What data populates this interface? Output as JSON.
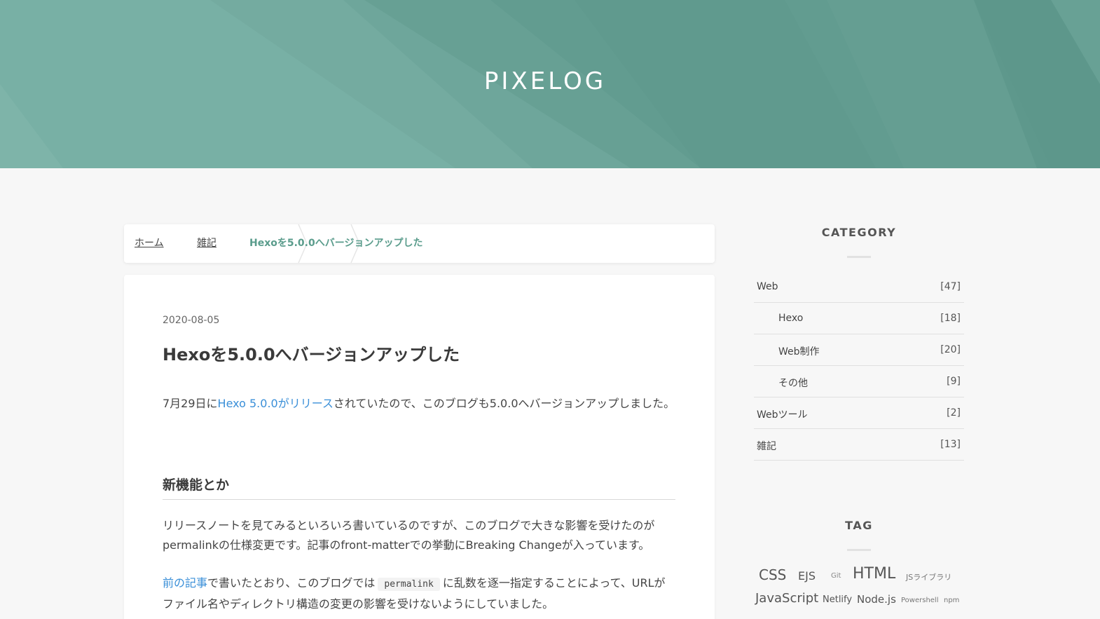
{
  "site": {
    "title": "PIXELOG"
  },
  "breadcrumb": {
    "home": "ホーム",
    "category": "雑記",
    "current": "Hexoを5.0.0へバージョンアップした"
  },
  "article": {
    "date": "2020-08-05",
    "title": "Hexoを5.0.0へバージョンアップした",
    "p1": {
      "before": "7月29日に",
      "link": "Hexo 5.0.0がリリース",
      "after": "されていたので、このブログも5.0.0へバージョンアップしました。"
    },
    "h2": "新機能とか",
    "p2": "リリースノートを見てみるといろいろ書いているのですが、このブログで大きな影響を受けたのがpermalinkの仕様変更です。記事のfront-matterでの挙動にBreaking Changeが入っています。",
    "p3": {
      "link": "前の記事",
      "before": "で書いたとおり、このブログでは",
      "code": "permalink",
      "after": "に乱数を逐一指定することによって、URLがファイル名やディレクトリ構造の変更の影響を受けないようにしていました。"
    }
  },
  "sidebar": {
    "category_title": "CATEGORY",
    "categories": [
      {
        "name": "Web",
        "count": "[47]",
        "child": false
      },
      {
        "name": "Hexo",
        "count": "[18]",
        "child": true
      },
      {
        "name": "Web制作",
        "count": "[20]",
        "child": true
      },
      {
        "name": "その他",
        "count": "[9]",
        "child": true
      },
      {
        "name": "Webツール",
        "count": "[2]",
        "child": false
      },
      {
        "name": "雑記",
        "count": "[13]",
        "child": false
      }
    ],
    "tag_title": "TAG",
    "tags": [
      "CSS",
      "EJS",
      "Git",
      "HTML",
      "JSライブラリ",
      "JavaScript",
      "Netlify",
      "Node.js",
      "Powershell",
      "npm"
    ]
  },
  "colors": {
    "header_bg": "#629c90",
    "accent": "#5a9c8c",
    "link": "#3a8fd8"
  }
}
